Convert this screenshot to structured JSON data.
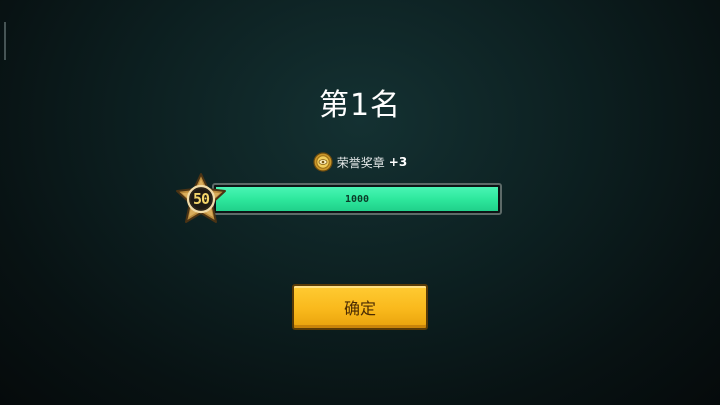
{
  "result": {
    "rank_title": "第1名"
  },
  "reward": {
    "icon": "honor-medal-icon",
    "label": "荣誉奖章",
    "amount": "+3"
  },
  "experience": {
    "level": "50",
    "bar_text": "1000",
    "fill_fraction": 1.0
  },
  "actions": {
    "confirm_label": "确定"
  },
  "colors": {
    "bar_fill": "#2ee89d",
    "button": "#f9b91c",
    "background": "#0d2122"
  }
}
